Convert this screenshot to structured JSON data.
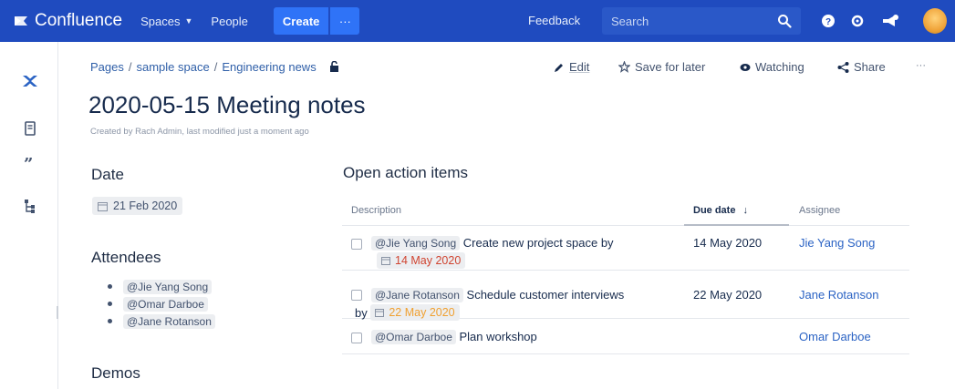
{
  "topnav": {
    "logo_text": "Confluence",
    "spaces_label": "Spaces",
    "people_label": "People",
    "create_label": "Create",
    "more_label": "···",
    "feedback_label": "Feedback",
    "search_placeholder": "Search",
    "colors": {
      "bar": "#1f4bbf",
      "create": "#2f73f7"
    }
  },
  "breadcrumb": {
    "items": [
      "Pages",
      "sample space",
      "Engineering news"
    ]
  },
  "page_actions": {
    "edit": "Edit",
    "save_for_later": "Save for later",
    "watching": "Watching",
    "share": "Share",
    "more": "···"
  },
  "page": {
    "title": "2020-05-15 Meeting notes",
    "byline": "Created by Rach Admin, last modified just a moment ago"
  },
  "date_section": {
    "heading": "Date",
    "date": "21 Feb 2020"
  },
  "attendees_section": {
    "heading": "Attendees",
    "people": [
      "@Jie Yang Song",
      "@Omar Darboe",
      "@Jane Rotanson"
    ]
  },
  "demos_section": {
    "heading": "Demos"
  },
  "action_items": {
    "heading": "Open action items",
    "columns": {
      "description": "Description",
      "due_date": "Due date",
      "sort_arrow": "↓",
      "assignee": "Assignee"
    },
    "rows": [
      {
        "mention": "@Jie Yang Song",
        "task": "Create new project space",
        "by": "by",
        "inline_date": "14 May 2020",
        "due": "14 May 2020",
        "assignee": "Jie Yang Song"
      },
      {
        "mention": "@Jane Rotanson",
        "task": "Schedule customer interviews",
        "by": "by",
        "inline_date": "22 May 2020",
        "due": "22 May 2020",
        "assignee": "Jane Rotanson"
      },
      {
        "mention": "@Omar Darboe",
        "task": "Plan workshop",
        "assignee": "Omar Darboe"
      }
    ]
  }
}
